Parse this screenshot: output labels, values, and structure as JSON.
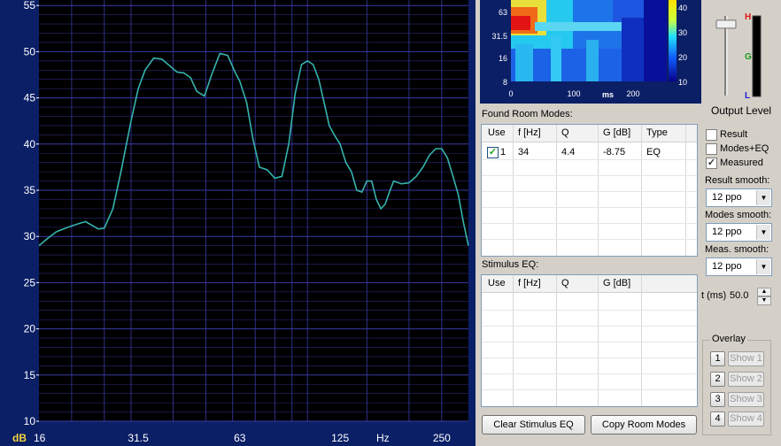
{
  "main_chart": {
    "x_ticks": [
      16,
      31.5,
      63,
      125,
      250
    ],
    "x_unit": "Hz",
    "y_unit": "dB",
    "y_ticks": [
      10,
      15,
      20,
      25,
      30,
      35,
      40,
      45,
      50,
      55
    ],
    "colors": {
      "background": "#000000",
      "frame": "#0b1f66",
      "grid": "#3a3aa8",
      "trace": "#36b3ad",
      "tick_text": "#ffffff",
      "unit_text": "#f5d33a"
    }
  },
  "chart_data": {
    "type": "line",
    "xscale": "log",
    "xlim": [
      16,
      300
    ],
    "ylim": [
      10,
      56
    ],
    "xlabel": "Hz",
    "ylabel": "dB",
    "grid": true,
    "series": [
      {
        "x": [
          16,
          17,
          18,
          19.5,
          21,
          22,
          23,
          24,
          25,
          26.5,
          28,
          30,
          31.5,
          33,
          35,
          37,
          39,
          41,
          43,
          45,
          47,
          49.5,
          52,
          55,
          58,
          61,
          63,
          66,
          69,
          72,
          76,
          80,
          84,
          88,
          92,
          96,
          100,
          104,
          108,
          112,
          116,
          120,
          125,
          130,
          135,
          140,
          145,
          150,
          155,
          160,
          165,
          170,
          175,
          180,
          190,
          200,
          210,
          220,
          230,
          240,
          250,
          260,
          270,
          280,
          290,
          300
        ],
        "y": [
          29,
          29.8,
          30.5,
          31,
          31.4,
          31.6,
          31.2,
          30.8,
          30.9,
          33,
          37,
          42.5,
          46,
          48,
          49.3,
          49.2,
          48.5,
          47.8,
          47.7,
          47.2,
          45.7,
          45.2,
          47.5,
          49.8,
          49.6,
          47.8,
          46.8,
          44.5,
          40.5,
          37.5,
          37.2,
          36.3,
          36.5,
          40,
          45.5,
          48.6,
          49,
          48.6,
          47,
          44.5,
          42,
          41,
          40,
          38,
          37,
          35,
          34.8,
          36,
          36,
          34,
          33,
          33.5,
          34.8,
          36,
          35.7,
          35.8,
          36.5,
          37.5,
          38.8,
          39.5,
          39.5,
          38.5,
          36.5,
          34.5,
          31.5,
          29
        ]
      }
    ]
  },
  "spectrogram": {
    "y_ticks": [
      "63",
      "31.5",
      "16",
      "8"
    ],
    "x_ticks": [
      "0",
      "100",
      "200"
    ],
    "x_unit": "ms",
    "colorbar_ticks": [
      "40",
      "30",
      "20",
      "10"
    ]
  },
  "output_level": {
    "title": "Output Level",
    "marks": {
      "high": "H",
      "good": "G",
      "low": "L"
    },
    "slider_value": 0.94
  },
  "room_modes": {
    "title": "Found Room Modes:",
    "columns": [
      "Use",
      "f [Hz]",
      "Q",
      "G [dB]",
      "Type"
    ],
    "rows": [
      {
        "checked": true,
        "index": "1",
        "freq": "34",
        "q": "4.4",
        "gain": "-8.75",
        "type": "EQ"
      }
    ]
  },
  "stimulus_eq": {
    "title": "Stimulus EQ:",
    "columns": [
      "Use",
      "f [Hz]",
      "Q",
      "G [dB]"
    ]
  },
  "options": {
    "result_label": "Result",
    "result_checked": false,
    "modes_eq_label": "Modes+EQ",
    "modes_eq_checked": false,
    "measured_label": "Measured",
    "measured_checked": true,
    "result_smooth_label": "Result smooth:",
    "result_smooth_value": "12 ppo",
    "modes_smooth_label": "Modes smooth:",
    "modes_smooth_value": "12 ppo",
    "meas_smooth_label": "Meas. smooth:",
    "meas_smooth_value": "12 ppo",
    "t_label": "t (ms)",
    "t_value": "50.0"
  },
  "overlay": {
    "title": "Overlay",
    "numbers": [
      "1",
      "2",
      "3",
      "4"
    ],
    "show_labels": [
      "Show 1",
      "Show 2",
      "Show 3",
      "Show 4"
    ]
  },
  "buttons": {
    "clear_stimulus_eq": "Clear Stimulus EQ",
    "copy_room_modes": "Copy Room Modes"
  }
}
